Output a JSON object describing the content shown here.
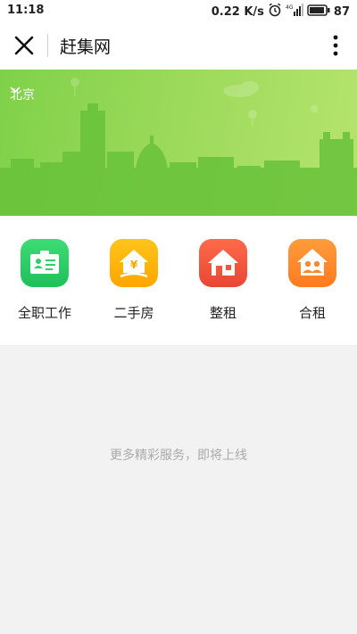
{
  "status_bar": {
    "time": "11:18",
    "network_speed": "0.22 K/s",
    "battery_percent": "87"
  },
  "nav": {
    "title": "赶集网",
    "close_icon": "close-icon",
    "more_icon": "more-vertical-icon"
  },
  "banner": {
    "city": "北京",
    "colors": {
      "start": "#7fd14a",
      "end": "#b6e46e"
    }
  },
  "services": [
    {
      "label": "全职工作",
      "icon": "id-card-icon",
      "color": "#2fcf6a"
    },
    {
      "label": "二手房",
      "icon": "house-yuan-icon",
      "color": "#ffb300"
    },
    {
      "label": "整租",
      "icon": "house-icon",
      "color": "#f2553f"
    },
    {
      "label": "合租",
      "icon": "house-people-icon",
      "color": "#ff8a2c"
    }
  ],
  "placeholder": "更多精彩服务，即将上线"
}
